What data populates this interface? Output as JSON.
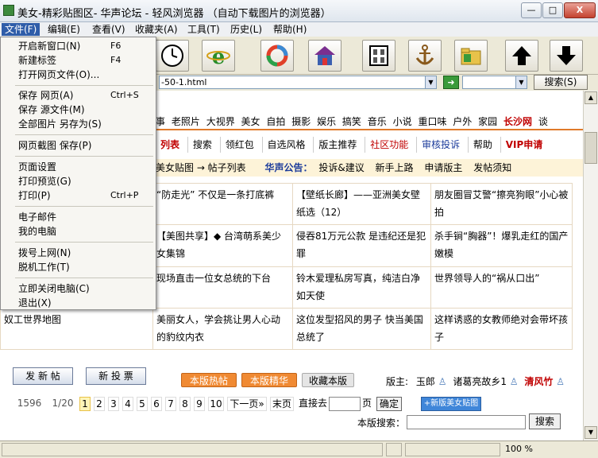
{
  "window": {
    "title": "美女-精彩贴图区- 华声论坛 - 轻风浏览器 （自动下载图片的浏览器）",
    "min_label": "—",
    "max_label": "□",
    "close_label": "X"
  },
  "menubar": [
    {
      "label": "文件(F)"
    },
    {
      "label": "编辑(E)"
    },
    {
      "label": "查看(V)"
    },
    {
      "label": "收藏夹(A)"
    },
    {
      "label": "工具(T)"
    },
    {
      "label": "历史(L)"
    },
    {
      "label": "帮助(H)"
    }
  ],
  "file_menu": [
    {
      "label": "开启新窗口(N)",
      "shortcut": "F6"
    },
    {
      "label": "新建标签",
      "shortcut": "F4"
    },
    {
      "label": "打开网页文件(O)...",
      "shortcut": ""
    },
    {
      "label": "保存 网页(A)",
      "shortcut": "Ctrl+S"
    },
    {
      "label": "保存 源文件(M)",
      "shortcut": ""
    },
    {
      "label": "全部图片 另存为(S)",
      "shortcut": ""
    },
    {
      "label": "网页截图 保存(P)",
      "shortcut": ""
    },
    {
      "label": "页面设置",
      "shortcut": ""
    },
    {
      "label": "打印预览(G)",
      "shortcut": ""
    },
    {
      "label": "打印(P)",
      "shortcut": "Ctrl+P"
    },
    {
      "label": "电子邮件",
      "shortcut": ""
    },
    {
      "label": "我的电脑",
      "shortcut": ""
    },
    {
      "label": "拨号上网(N)",
      "shortcut": ""
    },
    {
      "label": "脱机工作(T)",
      "shortcut": ""
    },
    {
      "label": "立即关闭电脑(C)",
      "shortcut": ""
    },
    {
      "label": "退出(X)",
      "shortcut": ""
    }
  ],
  "toolbar_icons": [
    "clock-icon",
    "ie-icon",
    "refresh-ring-icon",
    "home-icon",
    "gallery-icon",
    "anchor-icon",
    "folder-icon",
    "arrow-up-icon",
    "arrow-down-icon"
  ],
  "address": {
    "value": "-50-1.html",
    "search_label": "搜索(S)"
  },
  "site_nav": [
    "事",
    "老照片",
    "大视界",
    "美女",
    "自拍",
    "摄影",
    "娱乐",
    "搞笑",
    "音乐",
    "小说",
    "重口味",
    "户外",
    "家园",
    "长沙网",
    "谈"
  ],
  "sub_nav": [
    "列表",
    "搜索",
    "领红包",
    "自选风格",
    "版主推荐",
    "社区功能",
    "审核投诉",
    "帮助",
    "VIP申请"
  ],
  "breadcrumb": {
    "path": "美女贴图 → 帖子列表",
    "notice_label": "华声公告：",
    "links": [
      "投诉&建议",
      "新手上路",
      "申请版主",
      "发帖须知"
    ]
  },
  "posts": [
    [
      "",
      "“防走光” 不仅是一条打底裤",
      "【壁纸长廊】——亚洲美女壁纸选（12）",
      "朋友圈冒艾警“擦亮狗眼”小心被拍"
    ],
    [
      "",
      "【美图共享】◆ 台湾萌系美少女集锦",
      "侵吞81万元公款 是违纪还是犯罪",
      "杀手锏“胸器”！爆乳走红的国产嫩模"
    ],
    [
      "",
      "现场直击一位女总统的下台",
      "铃木爱理私房写真，纯洁白净如天使",
      "世界领导人的“祸从口出”"
    ],
    [
      "奴工世界地图",
      "美丽女人，学会挑让男人心动的豹纹内衣",
      "这位发型招风的男子 快当美国总统了",
      "这样诱惑的女教师绝对会带坏孩子"
    ]
  ],
  "actions": {
    "new_post": "发 新 帖",
    "new_vote": "新 投 票",
    "hot": "本版热帖",
    "best": "本版精华",
    "favorite": "收藏本版",
    "moderator_label": "版主:",
    "moderators": [
      "玉郎",
      "诸葛亮故乡1",
      "清风竹"
    ]
  },
  "pagination": {
    "total": "1596",
    "page_of": "1/20",
    "pages": [
      "1",
      "2",
      "3",
      "4",
      "5",
      "6",
      "7",
      "8",
      "9",
      "10"
    ],
    "next": "下一页»",
    "last": "末页",
    "goto_label": "直接去",
    "page_unit": "页",
    "confirm": "确定",
    "new_post_link": "+新版美女贴图"
  },
  "search_bar": {
    "label": "本版搜索：",
    "button": "搜索"
  },
  "status": {
    "zoom": "100 %"
  }
}
